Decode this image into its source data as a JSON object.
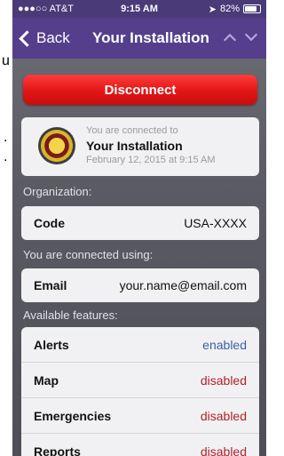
{
  "edge_text": {
    "a": "u",
    "b": ".",
    "c": "."
  },
  "status_bar": {
    "carrier": "●●●○○ AT&T",
    "time": "9:15 AM",
    "battery": "82%"
  },
  "nav": {
    "back_label": "Back",
    "title": "Your Installation"
  },
  "disconnect_label": "Disconnect",
  "connection": {
    "line1": "You are connected to",
    "name": "Your Installation",
    "date": "February 12, 2015 at 9:15 AM"
  },
  "organization": {
    "section": "Organization:",
    "key": "Code",
    "value": "USA-XXXX"
  },
  "using": {
    "section": "You are connected using:",
    "key": "Email",
    "value": "your.name@email.com"
  },
  "features": {
    "section": "Available features:",
    "items": [
      {
        "name": "Alerts",
        "status": "enabled"
      },
      {
        "name": "Map",
        "status": "disabled"
      },
      {
        "name": "Emergencies",
        "status": "disabled"
      },
      {
        "name": "Reports",
        "status": "disabled"
      }
    ]
  },
  "colors": {
    "nav_bg": "#553f8c",
    "disconnect_red": "#e21616",
    "enabled_blue": "#3a5fa8",
    "disabled_red": "#b32029"
  }
}
